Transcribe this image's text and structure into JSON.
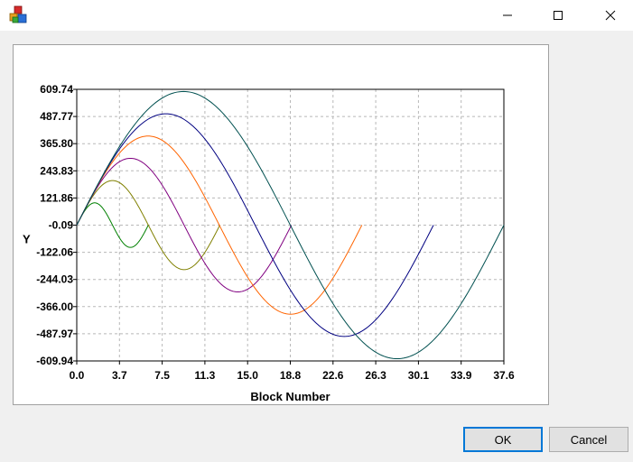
{
  "window": {
    "icon": "app-cubes-icon",
    "controls": [
      "minimize-icon",
      "maximize-icon",
      "close-icon"
    ]
  },
  "buttons": {
    "ok": "OK",
    "cancel": "Cancel"
  },
  "chart_data": {
    "type": "line",
    "title": "",
    "xlabel": "Block Number",
    "ylabel": "Y",
    "xlim": [
      0.0,
      37.6
    ],
    "ylim": [
      -609.94,
      609.74
    ],
    "x_ticks": [
      "0.0",
      "3.7",
      "7.5",
      "11.3",
      "15.0",
      "18.8",
      "22.6",
      "26.3",
      "30.1",
      "33.9",
      "37.6"
    ],
    "y_ticks": [
      "609.74",
      "487.77",
      "365.80",
      "243.83",
      "121.86",
      "-0.09",
      "-122.06",
      "-244.03",
      "-366.00",
      "-487.97",
      "-609.94"
    ],
    "grid": true,
    "legend": "none",
    "series": [
      {
        "color": "#008000",
        "amplitude": 100,
        "x_end": 6.3
      },
      {
        "color": "#808000",
        "amplitude": 200,
        "x_end": 12.6
      },
      {
        "color": "#800080",
        "amplitude": 300,
        "x_end": 18.9
      },
      {
        "color": "#ff6400",
        "amplitude": 400,
        "x_end": 25.1
      },
      {
        "color": "#000080",
        "amplitude": 500,
        "x_end": 31.4
      },
      {
        "color": "#005050",
        "amplitude": 600,
        "x_end": 37.6
      }
    ]
  }
}
